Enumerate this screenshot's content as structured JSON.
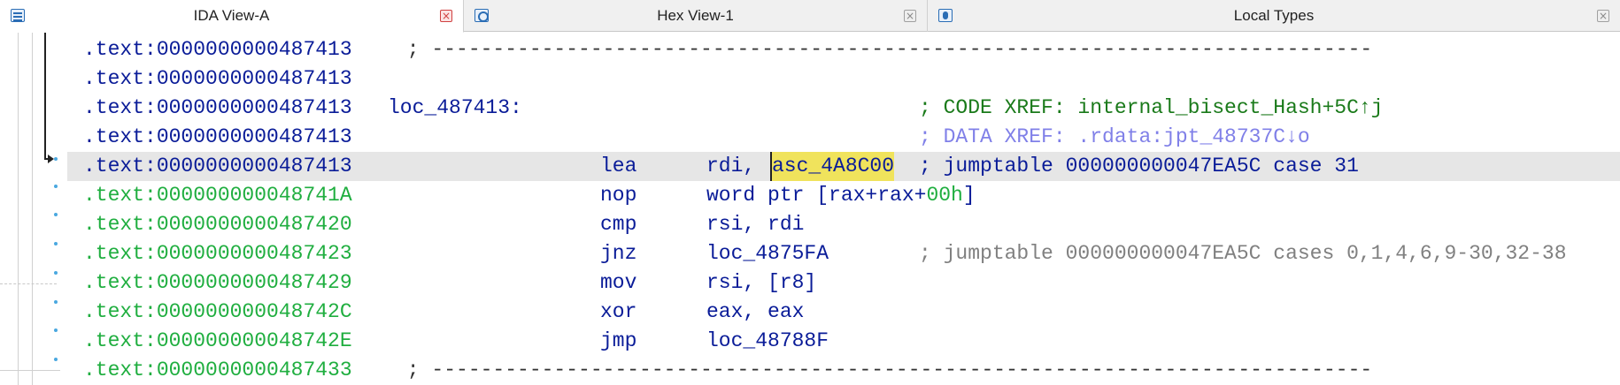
{
  "tabs": [
    {
      "label": "IDA View-A",
      "icon": "ida-view-icon",
      "active": true
    },
    {
      "label": "Hex View-1",
      "icon": "hex-view-icon",
      "active": false
    },
    {
      "label": "Local Types",
      "icon": "local-types-icon",
      "active": false
    }
  ],
  "listing": {
    "rows": [
      {
        "addr": ".text:0000000000487413",
        "text": " ; -----------------------------------------------------------------------------"
      },
      {
        "addr": ".text:0000000000487413"
      },
      {
        "addr": ".text:0000000000487413",
        "label": "loc_487413:",
        "comment": "; CODE XREF: internal_bisect_Hash+5C↑j"
      },
      {
        "addr": ".text:0000000000487413",
        "comment": "; DATA XREF: .rdata:jpt_48737C↓o"
      },
      {
        "addr": ".text:0000000000487413",
        "mnemonic": "lea",
        "operand_prefix": "rdi, ",
        "operand_symbol": "asc_4A8C00",
        "comment": "; jumptable 000000000047EA5C case 31"
      },
      {
        "addr": ".text:000000000048741A",
        "mnemonic": "nop",
        "operand_prefix": "word ptr [rax+rax+",
        "operand_imm": "00h",
        "operand_suffix": "]"
      },
      {
        "addr": ".text:0000000000487420",
        "mnemonic": "cmp",
        "operand_prefix": "rsi, rdi"
      },
      {
        "addr": ".text:0000000000487423",
        "mnemonic": "jnz",
        "operand_prefix": "loc_4875FA",
        "comment": "; jumptable 000000000047EA5C cases 0,1,4,6,9-30,32-38"
      },
      {
        "addr": ".text:0000000000487429",
        "mnemonic": "mov",
        "operand_prefix": "rsi, [r8]"
      },
      {
        "addr": ".text:000000000048742C",
        "mnemonic": "xor",
        "operand_prefix": "eax, eax"
      },
      {
        "addr": ".text:000000000048742E",
        "mnemonic": "jmp",
        "operand_prefix": "loc_48788F"
      },
      {
        "addr": ".text:0000000000487433",
        "text": " ; -----------------------------------------------------------------------------"
      }
    ]
  },
  "colors": {
    "address_blue": "#0a1c98",
    "address_green": "#1fae3f",
    "highlight_symbol": "#f0e35c",
    "current_line": "#e6e6e6"
  }
}
